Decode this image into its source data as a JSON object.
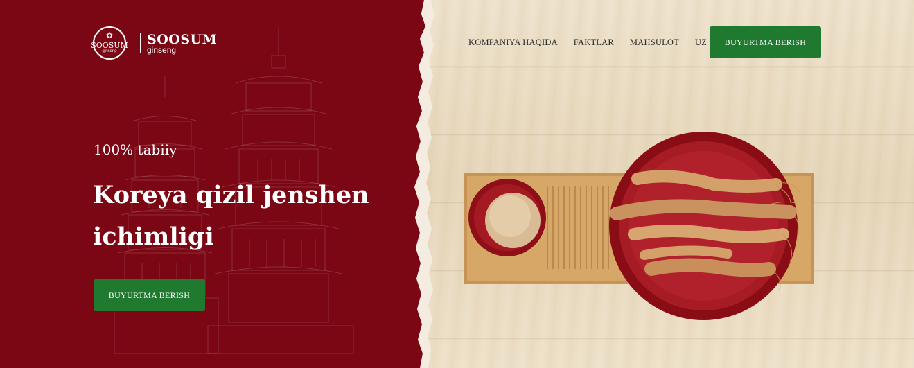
{
  "colors": {
    "panel_red": "#7a0713",
    "cta_green": "#1f7a2f",
    "wood": "#ebdfc7",
    "nav_text": "#2a2a2a"
  },
  "logo": {
    "badge_text": "SOOSUM",
    "badge_sub": "ginseng",
    "brand": "SOOSUM",
    "tag": "ginseng"
  },
  "nav": {
    "items": [
      {
        "label": "KOMPANIYA HAQIDA"
      },
      {
        "label": "FAKTLAR"
      },
      {
        "label": "MAHSULOT"
      },
      {
        "label": "UZ"
      }
    ],
    "cta_label": "BUYURTMA BERISH"
  },
  "hero": {
    "subtitle": "100% tabiiy",
    "title": "Koreya qizil jenshen ichimligi",
    "cta_label": "BUYURTMA BERISH"
  },
  "icons": {
    "background_art": "pagoda-illustration",
    "product_image": "ginseng-roots-and-powder"
  }
}
